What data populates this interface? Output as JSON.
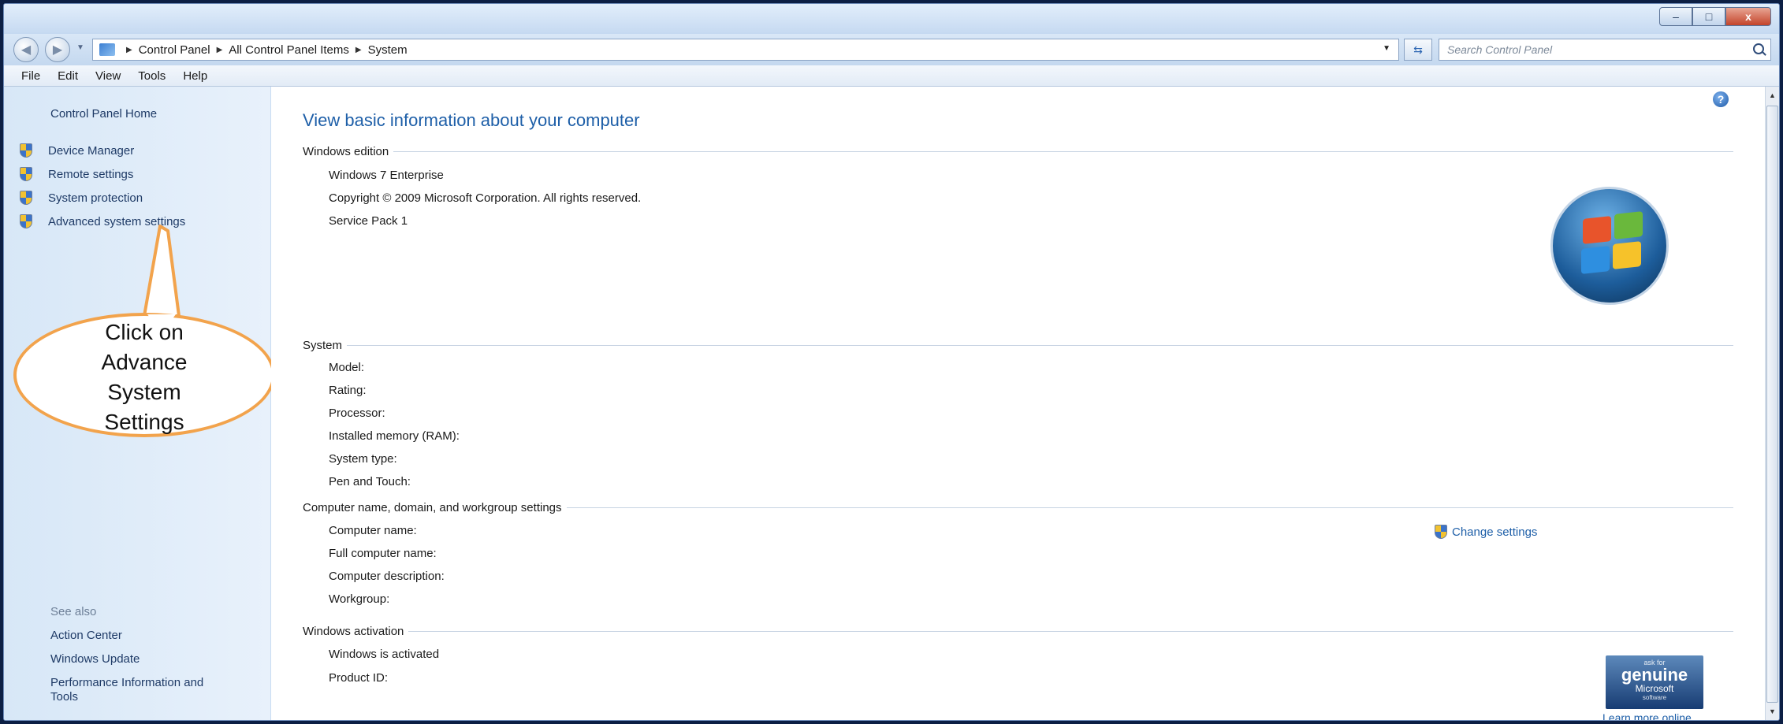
{
  "window": {
    "buttons": {
      "minimize": "–",
      "maximize": "□",
      "close": "x"
    }
  },
  "nav": {
    "back_icon": "back-arrow-icon",
    "forward_icon": "forward-arrow-icon",
    "recent_icon": "chevron-down-icon"
  },
  "address": {
    "crumbs": [
      "Control Panel",
      "All Control Panel Items",
      "System"
    ],
    "separator": "▶"
  },
  "search": {
    "placeholder": "Search Control Panel"
  },
  "menu": [
    "File",
    "Edit",
    "View",
    "Tools",
    "Help"
  ],
  "left": {
    "home": "Control Panel Home",
    "tasks": [
      "Device Manager",
      "Remote settings",
      "System protection",
      "Advanced system settings"
    ],
    "see_also": "See also",
    "links": [
      "Action Center",
      "Windows Update",
      "Performance Information and",
      "Tools"
    ]
  },
  "callout": {
    "lines": [
      "Click on",
      "Advance",
      "System",
      "Settings"
    ],
    "border_color": "#f2a34c"
  },
  "main": {
    "heading": "View basic information about your computer",
    "edition": {
      "title": "Windows edition",
      "lines": [
        "Windows 7 Enterprise",
        "Copyright © 2009 Microsoft Corporation.  All rights reserved.",
        "Service Pack 1"
      ]
    },
    "system": {
      "title": "System",
      "lines": [
        "Model:",
        "Rating:",
        "Processor:",
        "Installed memory (RAM):",
        "System type:",
        "Pen and Touch:"
      ]
    },
    "computer": {
      "title": "Computer name, domain, and workgroup settings",
      "lines": [
        "Computer name:",
        "Full computer name:",
        "Computer description:",
        "Workgroup:"
      ],
      "change_settings": "Change settings"
    },
    "activation": {
      "title": "Windows activation",
      "lines": [
        "Windows is activated",
        "Product ID:"
      ],
      "genuine": {
        "top": "ask for",
        "main": "genuine",
        "brand": "Microsoft",
        "bottom": "software"
      },
      "learn_more": "Learn more online..."
    }
  },
  "colors": {
    "link": "#1e5fa8",
    "accent_orange": "#f2a34c"
  }
}
